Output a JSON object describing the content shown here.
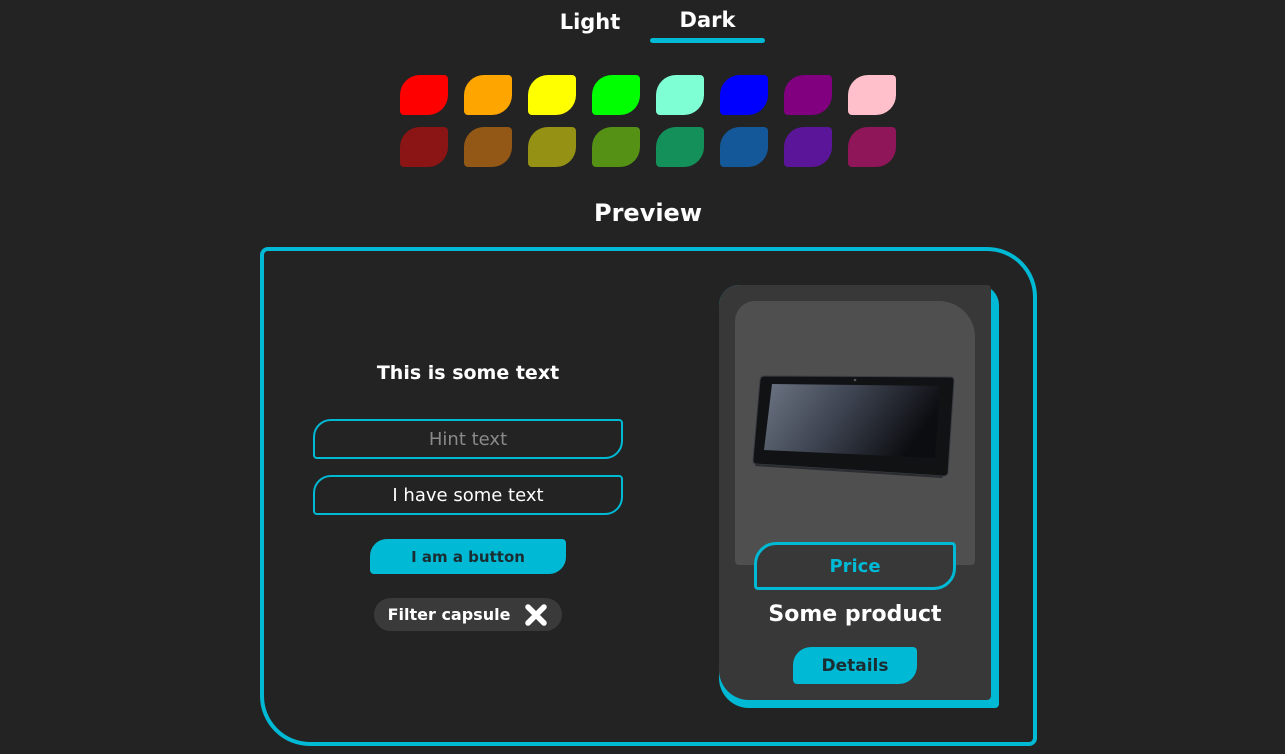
{
  "theme_tabs": {
    "light_label": "Light",
    "dark_label": "Dark",
    "selected": "Dark"
  },
  "color_palette": {
    "top_row": [
      "#ff0000",
      "#ffa500",
      "#ffff00",
      "#00ff00",
      "#7fffd4",
      "#0000ff",
      "#800080",
      "#ffc0cb"
    ],
    "bottom_row": [
      "#8b1414",
      "#935815",
      "#949115",
      "#549114",
      "#14905a",
      "#14589a",
      "#5b1598",
      "#8f1659"
    ]
  },
  "preview": {
    "title": "Preview",
    "accent_color": "#00b9d4",
    "sample_text": "This is some text",
    "hint_field_placeholder": "Hint text",
    "filled_field_value": "I have some text",
    "button_label": "I am a button",
    "filter_capsule_label": "Filter capsule",
    "product_card": {
      "price_label": "Price",
      "product_name": "Some product",
      "details_label": "Details",
      "image_icon": "tablet-image"
    }
  }
}
